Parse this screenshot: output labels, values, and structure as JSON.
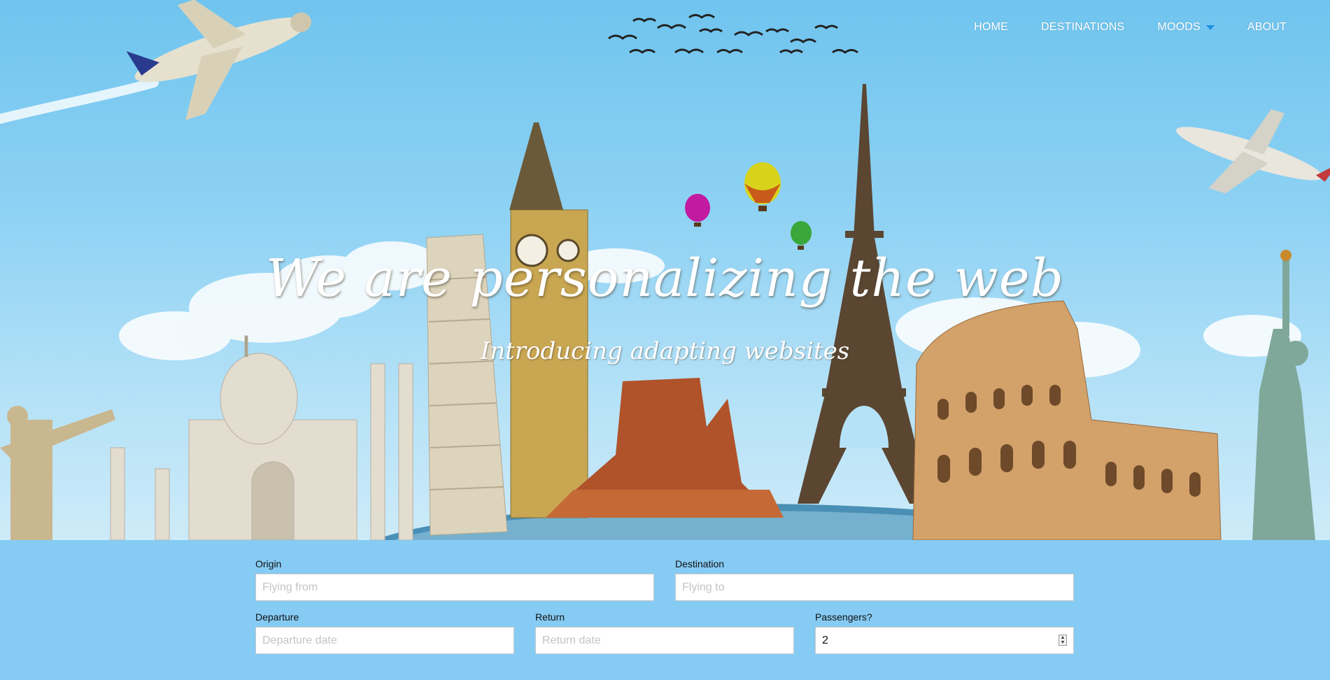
{
  "nav": {
    "items": [
      "HOME",
      "DESTINATIONS",
      "MOODS",
      "ABOUT"
    ],
    "moods_has_dropdown": true,
    "caret_color": "#1e8fe0"
  },
  "hero": {
    "title": "We are personalizing the web",
    "subtitle": "Introducing adapting websites"
  },
  "form": {
    "origin": {
      "label": "Origin",
      "placeholder": "Flying from",
      "value": ""
    },
    "destination": {
      "label": "Destination",
      "placeholder": "Flying to",
      "value": ""
    },
    "departure": {
      "label": "Departure",
      "placeholder": "Departure date",
      "value": ""
    },
    "return": {
      "label": "Return",
      "placeholder": "Return date",
      "value": ""
    },
    "passengers": {
      "label": "Passengers?",
      "value": "2"
    }
  },
  "colors": {
    "sky": "#8fd2f4",
    "form_band": "#86cbf4",
    "nav_text": "#ffffff"
  },
  "icons": [
    "airplane-icon",
    "bird-flock-icon",
    "hot-air-balloon-icon",
    "caret-down-icon",
    "number-stepper-icon"
  ]
}
